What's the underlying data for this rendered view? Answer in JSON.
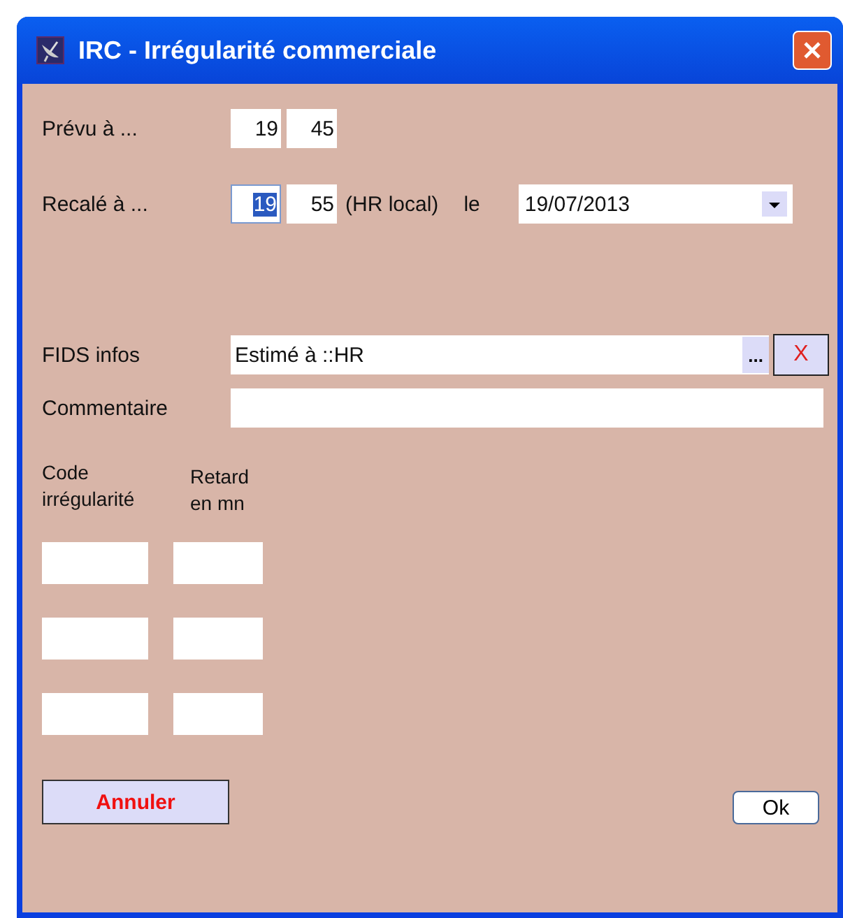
{
  "window": {
    "title": "IRC - Irrégularité commerciale"
  },
  "planned": {
    "label": "Prévu à ...",
    "hour": {
      "value": "19",
      "selected": false
    },
    "minute": {
      "value": "45",
      "selected": false
    }
  },
  "rescheduled": {
    "label": "Recalé à ...",
    "hour": {
      "value": "19",
      "selected": true
    },
    "minute": {
      "value": "55",
      "selected": false
    },
    "unit": "(HR local)",
    "date_label": "le",
    "date": "19/07/2013"
  },
  "fids": {
    "label": "FIDS infos",
    "value": "Estimé à ::HR",
    "browse": "...",
    "clear": "X"
  },
  "comment": {
    "label": "Commentaire"
  },
  "columns": [
    "Code\nirrégularité",
    "Retard\nen mn"
  ],
  "rows": [
    {},
    {},
    {}
  ],
  "buttons": {
    "cancel": "Annuler",
    "ok": "Ok"
  }
}
